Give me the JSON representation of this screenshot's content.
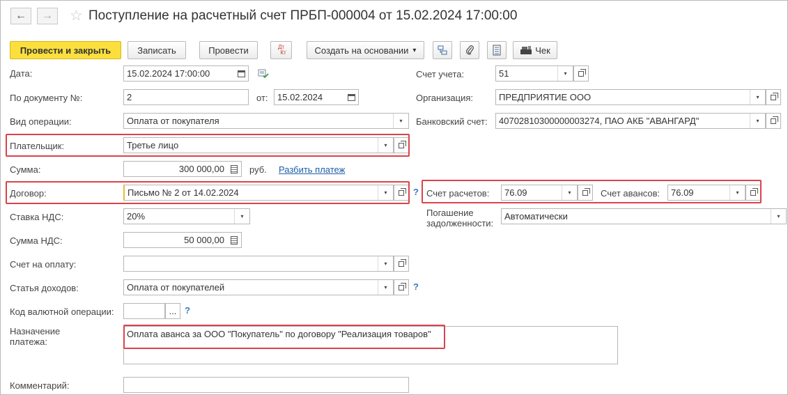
{
  "window": {
    "title": "Поступление на расчетный счет ПРБП-000004 от 15.02.2024 17:00:00",
    "back_icon": "arrow-left-icon",
    "forward_icon": "arrow-right-icon",
    "back_glyph": "←",
    "forward_glyph": "→",
    "star_glyph": "☆"
  },
  "toolbar": {
    "post_and_close": "Провести и закрыть",
    "save": "Записать",
    "post": "Провести",
    "dt_label": "Дт",
    "kt_label": "Кт",
    "create_based_on": "Создать на основании",
    "dropdown_glyph": "▾",
    "receipt": "Чек"
  },
  "form": {
    "date": {
      "label": "Дата:",
      "value": "15.02.2024 17:00:00"
    },
    "doc_number": {
      "label": "По документу №:",
      "value": "2",
      "from_label": "от:",
      "from_value": "15.02.2024"
    },
    "operation_type": {
      "label": "Вид операции:",
      "value": "Оплата от покупателя"
    },
    "payer": {
      "label": "Плательщик:",
      "value": "Третье лицо"
    },
    "amount": {
      "label": "Сумма:",
      "value": "300 000,00",
      "currency": "руб.",
      "split_link": "Разбить платеж"
    },
    "contract": {
      "label": "Договор:",
      "value": "Письмо № 2 от 14.02.2024"
    },
    "vat_rate": {
      "label": "Ставка НДС:",
      "value": "20%"
    },
    "vat_amount": {
      "label": "Сумма НДС:",
      "value": "50 000,00"
    },
    "invoice": {
      "label": "Счет на оплату:",
      "value": ""
    },
    "income_item": {
      "label": "Статья доходов:",
      "value": "Оплата от покупателей"
    },
    "currency_op_code": {
      "label": "Код валютной операции:",
      "value": "",
      "select_glyph": "..."
    },
    "purpose": {
      "label": "Назначение платежа:",
      "value": "Оплата аванса за ООО \"Покупатель\" по договору \"Реализация товаров\""
    },
    "comment": {
      "label": "Комментарий:",
      "value": ""
    },
    "account": {
      "label": "Счет учета:",
      "value": "51"
    },
    "organization": {
      "label": "Организация:",
      "value": "ПРЕДПРИЯТИЕ ООО"
    },
    "bank_account": {
      "label": "Банковский счет:",
      "value": "40702810300000003274, ПАО АКБ \"АВАНГАРД\""
    },
    "settlement_account": {
      "label": "Счет расчетов:",
      "value": "76.09"
    },
    "advance_account": {
      "label": "Счет авансов:",
      "value": "76.09"
    },
    "debt_repayment": {
      "label_line1": "Погашение",
      "label_line2": "задолженности:",
      "value": "Автоматически"
    },
    "help_glyph": "?"
  },
  "colors": {
    "highlight": "#d9434b",
    "primary_button": "#fbe03d",
    "link": "#1c5ea8",
    "help": "#3a7bbf"
  }
}
